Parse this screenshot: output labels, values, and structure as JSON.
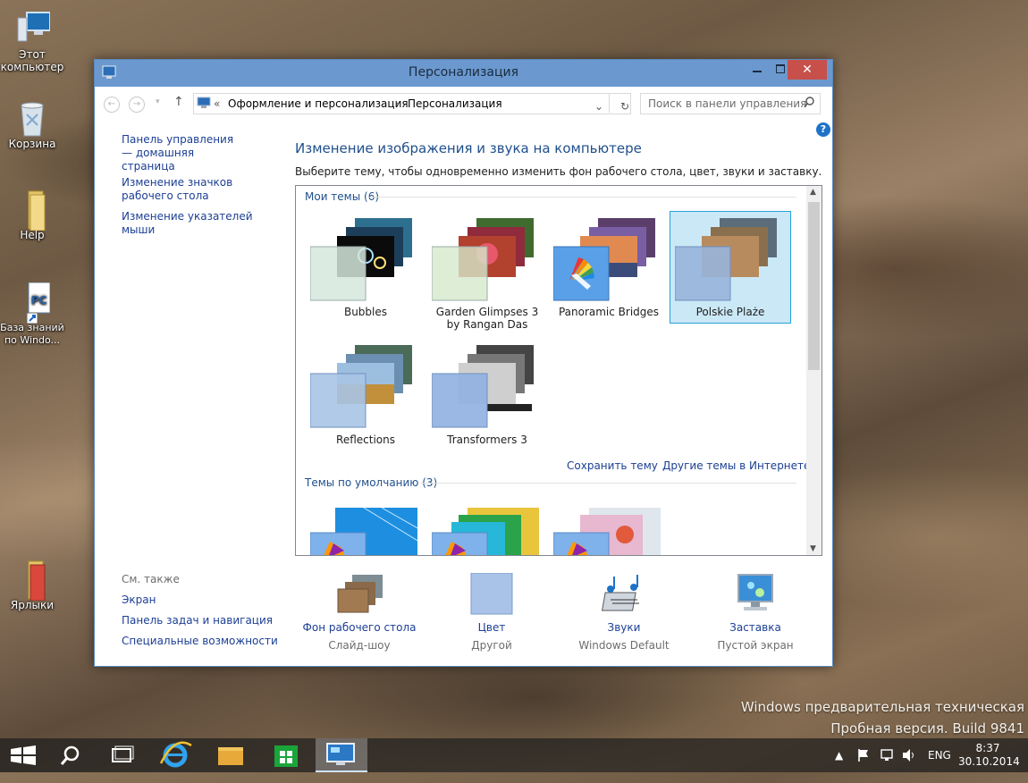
{
  "desktop": {
    "icons": [
      {
        "label": "Этот компьютер",
        "icon": "monitor-icon"
      },
      {
        "label": "Корзина",
        "icon": "recycle-bin-icon"
      },
      {
        "label": "Help",
        "icon": "folder-icon"
      },
      {
        "label": "База знаний по Windo...",
        "icon": "document-shortcut-icon"
      },
      {
        "label": "Ярлыки",
        "icon": "folder-icon"
      }
    ],
    "watermark_line1": "Windows предварительная техническая",
    "watermark_line2": "Пробная версия. Build 9841"
  },
  "window": {
    "title": "Персонализация",
    "address": {
      "prefix": "«",
      "crumb1": "Оформление и персонализация",
      "separator": "›",
      "crumb2": "Персонализация"
    },
    "search_placeholder": "Поиск в панели управления",
    "help_glyph": "?"
  },
  "sidebar": {
    "links": [
      {
        "label": "Панель управления — домашняя страница"
      },
      {
        "label": "Изменение значков рабочего стола"
      },
      {
        "label": "Изменение указателей мыши"
      }
    ],
    "see_also_title": "См. также",
    "see_also": [
      {
        "label": "Экран"
      },
      {
        "label": "Панель задач и навигация"
      },
      {
        "label": "Специальные возможности"
      }
    ]
  },
  "main": {
    "heading": "Изменение изображения и звука на компьютере",
    "subtext": "Выберите тему, чтобы одновременно изменить фон рабочего стола, цвет, звуки и заставку.",
    "my_themes_title": "Мои темы (6)",
    "my_themes": [
      {
        "label": "Bubbles",
        "selected": false
      },
      {
        "label": "Garden Glimpses 3 by Rangan Das",
        "selected": false
      },
      {
        "label": "Panoramic Bridges",
        "selected": false
      },
      {
        "label": "Polskie Plaże",
        "selected": true
      },
      {
        "label": "Reflections",
        "selected": false
      },
      {
        "label": "Transformers 3",
        "selected": false
      }
    ],
    "save_theme": "Сохранить тему",
    "more_themes": "Другие темы в Интернете",
    "default_themes_title": "Темы по умолчанию (3)"
  },
  "bottom": [
    {
      "label": "Фон рабочего стола",
      "sub": "Слайд-шоу",
      "icon": "wallpaper-icon"
    },
    {
      "label": "Цвет",
      "sub": "Другой",
      "icon": "color-swatch-icon"
    },
    {
      "label": "Звуки",
      "sub": "Windows Default",
      "icon": "sound-notes-icon"
    },
    {
      "label": "Заставка",
      "sub": "Пустой экран",
      "icon": "screensaver-icon"
    }
  ],
  "taskbar": {
    "language": "ENG",
    "time": "8:37",
    "date": "30.10.2014"
  },
  "colors": {
    "titlebar": "#6b99cf",
    "close": "#c7504a",
    "link": "#1c3f94",
    "heading": "#1f4f8c",
    "selected_bg": "#cbe8f6"
  }
}
